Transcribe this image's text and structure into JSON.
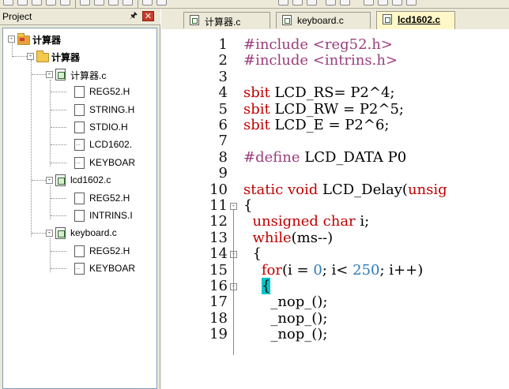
{
  "project_panel": {
    "title": "Project",
    "pin_icon": "pin-icon",
    "close_icon": "close-icon",
    "tree": [
      {
        "label": "计算器",
        "type": "target",
        "expander": "−",
        "indent": 0
      },
      {
        "label": "计算器",
        "type": "group",
        "expander": "−",
        "indent": 1
      },
      {
        "label": "计算器.c",
        "type": "cfile",
        "expander": "−",
        "indent": 2
      },
      {
        "label": "REG52.H",
        "type": "hfile",
        "expander": "",
        "indent": 3
      },
      {
        "label": "STRING.H",
        "type": "hfile",
        "expander": "",
        "indent": 3
      },
      {
        "label": "STDIO.H",
        "type": "hfile",
        "expander": "",
        "indent": 3
      },
      {
        "label": "LCD1602.",
        "type": "libfile",
        "expander": "",
        "indent": 3
      },
      {
        "label": "KEYBOAR",
        "type": "libfile",
        "expander": "",
        "indent": 3
      },
      {
        "label": "lcd1602.c",
        "type": "cfile",
        "expander": "−",
        "indent": 2
      },
      {
        "label": "REG52.H",
        "type": "hfile",
        "expander": "",
        "indent": 3
      },
      {
        "label": "INTRINS.I",
        "type": "hfile",
        "expander": "",
        "indent": 3
      },
      {
        "label": "keyboard.c",
        "type": "cfile",
        "expander": "−",
        "indent": 2
      },
      {
        "label": "REG52.H",
        "type": "hfile",
        "expander": "",
        "indent": 3
      },
      {
        "label": "KEYBOAR",
        "type": "libfile",
        "expander": "",
        "indent": 3
      }
    ]
  },
  "tabs": [
    {
      "label": "计算器.c",
      "active": false
    },
    {
      "label": "keyboard.c",
      "active": false
    },
    {
      "label": "lcd1602.c",
      "active": true
    }
  ],
  "editor": {
    "lines": [
      {
        "n": "1",
        "tokens": [
          [
            "pp",
            "#include <reg52.h>"
          ]
        ]
      },
      {
        "n": "2",
        "tokens": [
          [
            "pp",
            "#include <intrins.h>"
          ]
        ]
      },
      {
        "n": "3",
        "tokens": []
      },
      {
        "n": "4",
        "tokens": [
          [
            "kw",
            "sbit"
          ],
          [
            "txt",
            " LCD_RS= P2^4;"
          ]
        ]
      },
      {
        "n": "5",
        "tokens": [
          [
            "kw",
            "sbit"
          ],
          [
            "txt",
            " LCD_RW = P2^5;"
          ]
        ]
      },
      {
        "n": "6",
        "tokens": [
          [
            "kw",
            "sbit"
          ],
          [
            "txt",
            " LCD_E = P2^6;"
          ]
        ]
      },
      {
        "n": "7",
        "tokens": []
      },
      {
        "n": "8",
        "tokens": [
          [
            "pp",
            "#define"
          ],
          [
            "txt",
            " LCD_DATA P0"
          ]
        ]
      },
      {
        "n": "9",
        "tokens": []
      },
      {
        "n": "10",
        "tokens": [
          [
            "kw",
            "static void"
          ],
          [
            "txt",
            " LCD_Delay("
          ],
          [
            "kw",
            "unsig"
          ]
        ]
      },
      {
        "n": "11",
        "tokens": [
          [
            "txt",
            "{"
          ]
        ],
        "fold": "−"
      },
      {
        "n": "12",
        "tokens": [
          [
            "txt",
            "  "
          ],
          [
            "kw",
            "unsigned char"
          ],
          [
            "txt",
            " i;"
          ]
        ]
      },
      {
        "n": "13",
        "tokens": [
          [
            "txt",
            "  "
          ],
          [
            "kw",
            "while"
          ],
          [
            "txt",
            "(ms--)"
          ]
        ]
      },
      {
        "n": "14",
        "tokens": [
          [
            "txt",
            "  {"
          ]
        ],
        "fold": "−"
      },
      {
        "n": "15",
        "tokens": [
          [
            "txt",
            "    "
          ],
          [
            "kw",
            "for"
          ],
          [
            "txt",
            "(i = "
          ],
          [
            "num",
            "0"
          ],
          [
            "txt",
            "; i< "
          ],
          [
            "num",
            "250"
          ],
          [
            "txt",
            "; i++)"
          ]
        ]
      },
      {
        "n": "16",
        "tokens": [
          [
            "txt",
            "    "
          ],
          [
            "hl",
            "{"
          ]
        ],
        "fold": "−"
      },
      {
        "n": "17",
        "tokens": [
          [
            "txt",
            "      _nop_();"
          ]
        ]
      },
      {
        "n": "18",
        "tokens": [
          [
            "txt",
            "      _nop_();"
          ]
        ]
      },
      {
        "n": "19",
        "tokens": [
          [
            "txt",
            "      _nop_();"
          ]
        ]
      }
    ]
  }
}
